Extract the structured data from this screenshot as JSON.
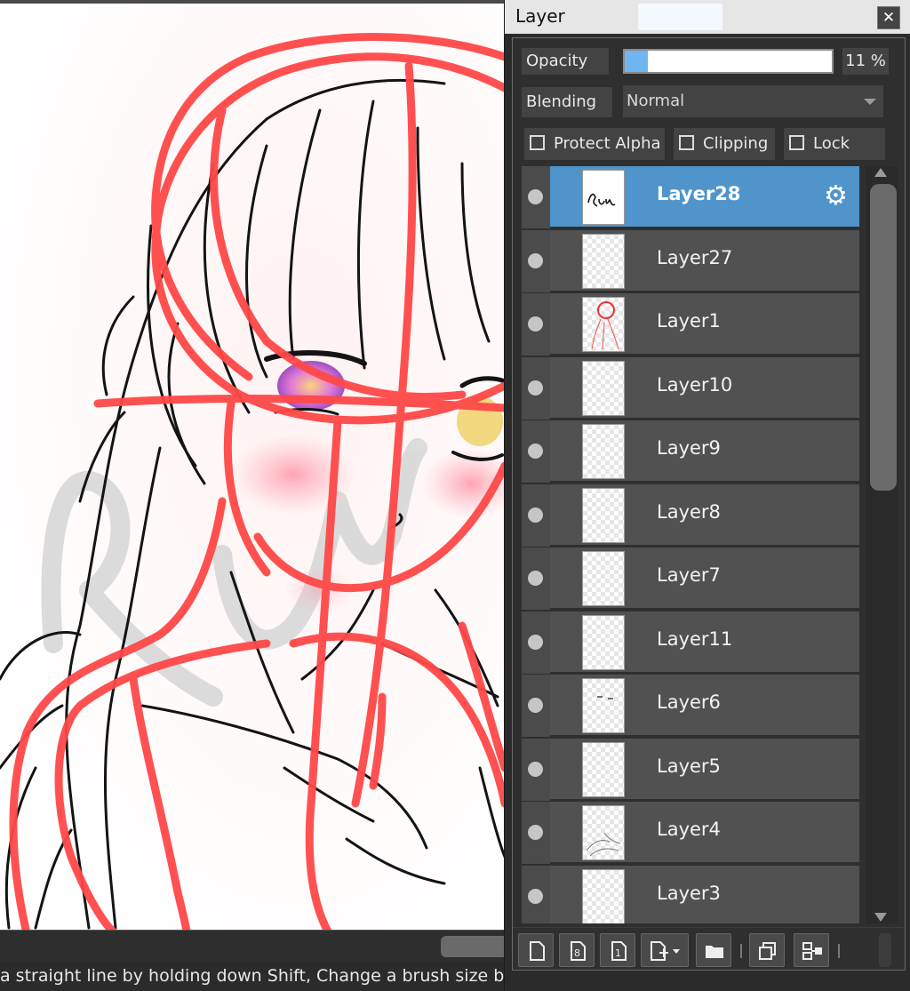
{
  "panel": {
    "title": "Layer",
    "close_icon": "✕",
    "opacity_label": "Opacity",
    "opacity_percent": 11,
    "opacity_value": "11 %",
    "blending_label": "Blending",
    "blending_value": "Normal",
    "protect_alpha_label": "Protect Alpha",
    "clipping_label": "Clipping",
    "lock_label": "Lock",
    "selected_color": "#4f95cc"
  },
  "layers": [
    {
      "name": "Layer28",
      "selected": true,
      "thumb": "scribble-run"
    },
    {
      "name": "Layer27",
      "selected": false,
      "thumb": "blank"
    },
    {
      "name": "Layer1",
      "selected": false,
      "thumb": "red-sketch"
    },
    {
      "name": "Layer10",
      "selected": false,
      "thumb": "blank"
    },
    {
      "name": "Layer9",
      "selected": false,
      "thumb": "blank"
    },
    {
      "name": "Layer8",
      "selected": false,
      "thumb": "blank"
    },
    {
      "name": "Layer7",
      "selected": false,
      "thumb": "blank"
    },
    {
      "name": "Layer11",
      "selected": false,
      "thumb": "blank"
    },
    {
      "name": "Layer6",
      "selected": false,
      "thumb": "eyes"
    },
    {
      "name": "Layer5",
      "selected": false,
      "thumb": "blank"
    },
    {
      "name": "Layer4",
      "selected": false,
      "thumb": "lineart"
    },
    {
      "name": "Layer3",
      "selected": false,
      "thumb": "blank"
    }
  ],
  "toolbar": {
    "buttons": [
      "new-layer-icon",
      "new-8bit-layer-icon",
      "new-1bit-layer-icon",
      "add-layer-menu-icon",
      "folder-icon",
      "duplicate-layer-icon",
      "merge-layer-icon"
    ]
  },
  "statusbar": {
    "hint": "a straight line by holding down Shift, Change a brush size by"
  }
}
